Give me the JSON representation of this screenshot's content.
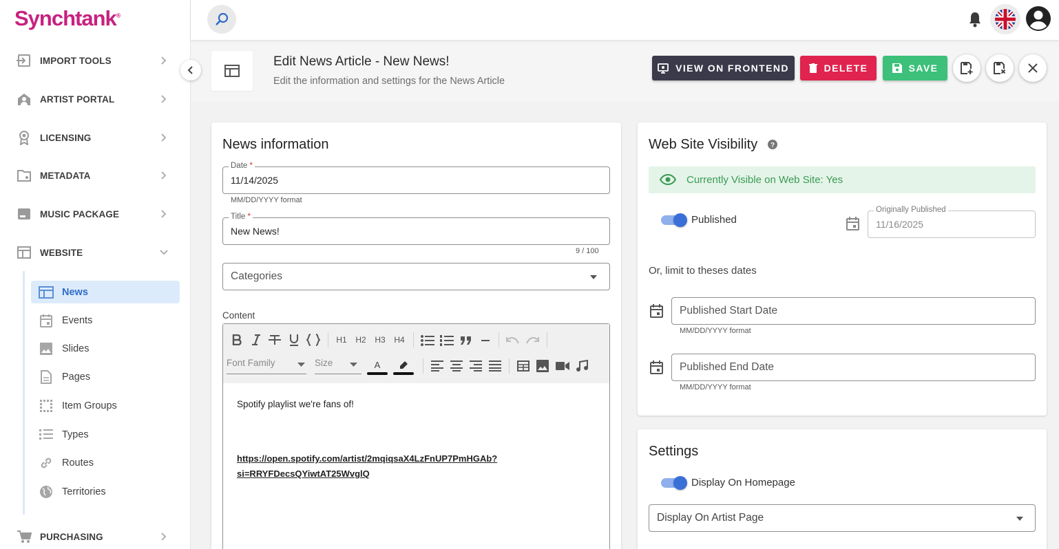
{
  "app": {
    "logo": "Synchtank",
    "logo_mark": "®"
  },
  "sidebar": {
    "sections": [
      {
        "label": "IMPORT TOOLS",
        "icon": "import-icon"
      },
      {
        "label": "ARTIST PORTAL",
        "icon": "artist-icon"
      },
      {
        "label": "LICENSING",
        "icon": "license-icon"
      },
      {
        "label": "METADATA",
        "icon": "folder-icon"
      },
      {
        "label": "MUSIC PACKAGE",
        "icon": "package-icon"
      },
      {
        "label": "WEBSITE",
        "icon": "website-icon"
      },
      {
        "label": "PURCHASING",
        "icon": "cart-icon"
      }
    ],
    "website_items": [
      {
        "label": "News",
        "active": true
      },
      {
        "label": "Events"
      },
      {
        "label": "Slides"
      },
      {
        "label": "Pages"
      },
      {
        "label": "Item Groups"
      },
      {
        "label": "Types"
      },
      {
        "label": "Routes"
      },
      {
        "label": "Territories"
      }
    ]
  },
  "header": {
    "title": "Edit News Article - New News!",
    "subtitle": "Edit the information and settings for the News Article",
    "buttons": {
      "view": "VIEW ON FRONTEND",
      "delete": "DELETE",
      "save": "SAVE"
    }
  },
  "news_info": {
    "title": "News information",
    "date": {
      "label": "Date",
      "required": "*",
      "value": "11/14/2025",
      "hint": "MM/DD/YYYY format"
    },
    "title_field": {
      "label": "Title",
      "required": "*",
      "value": "New News!",
      "counter": "9 / 100"
    },
    "categories": {
      "placeholder": "Categories"
    },
    "content": {
      "label": "Content",
      "toolbar": {
        "h1": "H1",
        "h2": "H2",
        "h3": "H3",
        "h4": "H4",
        "font_family": "Font Family",
        "size": "Size",
        "text_color": "A"
      },
      "body_text": "Spotify playlist we're fans of!",
      "link_line1": "https://open.spotify.com/artist/2mqiqsaX4LzFnUP7PmHGAb?",
      "link_line2": "si=RRYFDecsQYiwtAT25WvglQ"
    }
  },
  "visibility": {
    "title": "Web Site Visibility",
    "status": "Currently Visible on Web Site: Yes",
    "published_label": "Published",
    "published": true,
    "orig_label": "Originally Published",
    "orig_value": "11/16/2025",
    "limit_text": "Or, limit to theses dates",
    "start_placeholder": "Published Start Date",
    "end_placeholder": "Published End Date",
    "hint": "MM/DD/YYYY format"
  },
  "settings": {
    "title": "Settings",
    "homepage_label": "Display On Homepage",
    "homepage": true,
    "artist_page_placeholder": "Display On Artist Page"
  },
  "colors": {
    "brand": "#c8217f",
    "view_btn": "#3b3a4a",
    "delete_btn": "#e0244f",
    "save_btn": "#3cc07a",
    "accent": "#3a6fd8",
    "visible_bg": "#e4f4e8",
    "visible_text": "#3a9a55"
  }
}
